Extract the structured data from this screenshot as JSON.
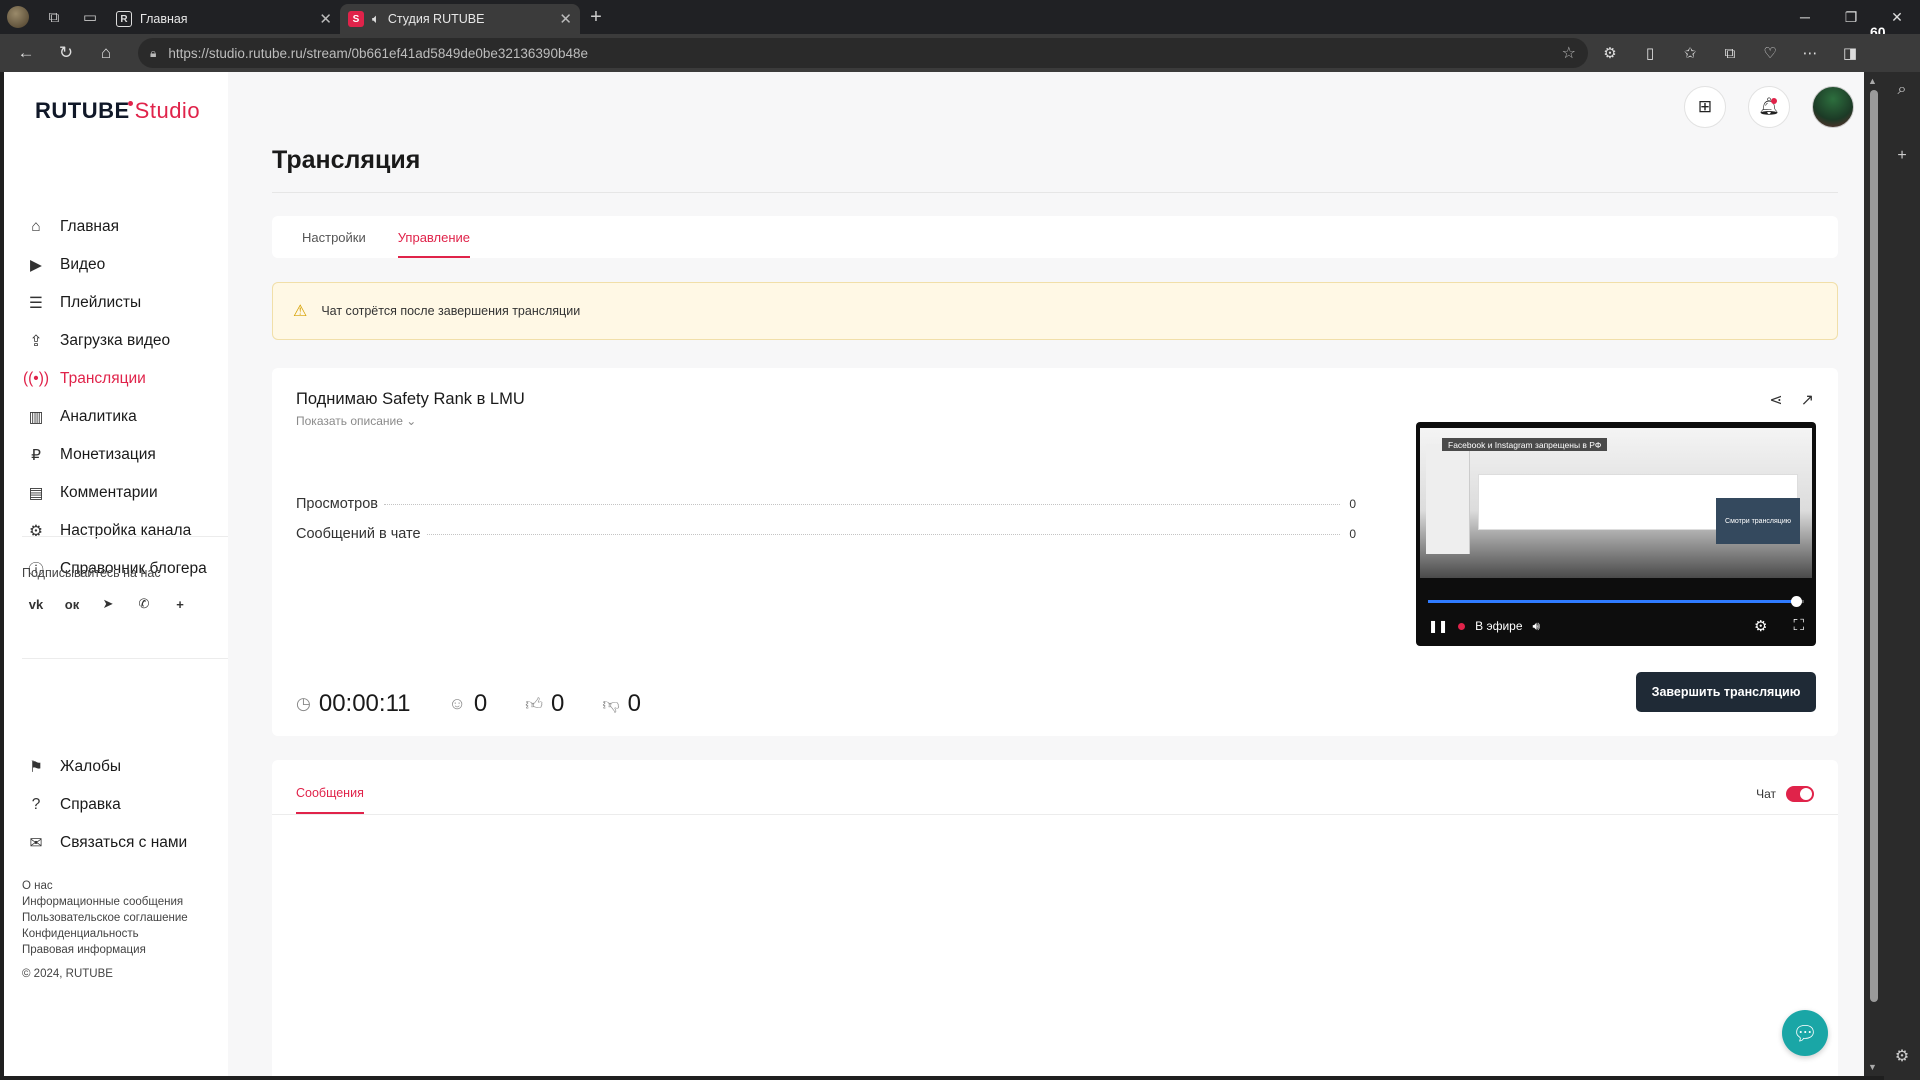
{
  "browser": {
    "tabs": [
      {
        "label": "Главная",
        "favicon": "R",
        "active": false
      },
      {
        "label": "Студия RUTUBE",
        "favicon": "S",
        "active": true
      }
    ],
    "url": "https://studio.rutube.ru/stream/0b661ef41ad5849de0be32136390b48e",
    "rail_count": "60"
  },
  "sidebar": {
    "logo": "RUTUBE",
    "logo_studio": "Studio",
    "menu": [
      {
        "label": "Главная",
        "icon": "home-icon"
      },
      {
        "label": "Видео",
        "icon": "video-icon"
      },
      {
        "label": "Плейлисты",
        "icon": "playlist-icon"
      },
      {
        "label": "Загрузка видео",
        "icon": "upload-icon"
      },
      {
        "label": "Трансляции",
        "icon": "broadcast-icon",
        "active": true
      },
      {
        "label": "Аналитика",
        "icon": "analytics-icon"
      },
      {
        "label": "Монетизация",
        "icon": "monetization-icon"
      },
      {
        "label": "Комментарии",
        "icon": "comments-icon"
      },
      {
        "label": "Настройка канала",
        "icon": "settings-icon"
      },
      {
        "label": "Справочник блогера",
        "icon": "guide-icon"
      }
    ],
    "subscribe_label": "Подписывайтесь на нас",
    "socials": [
      "vk-icon",
      "ok-icon",
      "telegram-icon",
      "viber-icon",
      "more-icon"
    ],
    "menu2": [
      {
        "label": "Жалобы",
        "icon": "flag-icon"
      },
      {
        "label": "Справка",
        "icon": "help-icon"
      },
      {
        "label": "Связаться с нами",
        "icon": "mail-icon"
      }
    ],
    "footer_links": [
      "О нас",
      "Информационные сообщения",
      "Пользовательское соглашение",
      "Конфиденциальность",
      "Правовая информация"
    ],
    "copyright": "© 2024, RUTUBE"
  },
  "main": {
    "title": "Трансляция",
    "tabs": [
      {
        "label": "Настройки",
        "active": false
      },
      {
        "label": "Управление",
        "active": true
      }
    ],
    "warning": "Чат сотрётся после завершения трансляции",
    "stream": {
      "title": "Поднимаю Safety Rank в LMU",
      "show_description": "Показать описание",
      "stats": [
        {
          "label": "Просмотров",
          "value": "0"
        },
        {
          "label": "Сообщений в чате",
          "value": "0"
        }
      ],
      "duration": "00:00:11",
      "viewers": "0",
      "likes": "0",
      "dislikes": "0",
      "end_button": "Завершить трансляцию",
      "player": {
        "banner": "Facebook и Instagram запрещены в РФ",
        "live_label": "В эфире",
        "mini_card_text": "Смотри трансляцию",
        "progress": 0.98
      }
    },
    "messages": {
      "tab_label": "Сообщения",
      "chat_label": "Чат",
      "chat_enabled": true
    }
  },
  "colors": {
    "accent": "#e0234a",
    "dark_button": "#1f2a36",
    "help_fab": "#1aa6a6"
  }
}
